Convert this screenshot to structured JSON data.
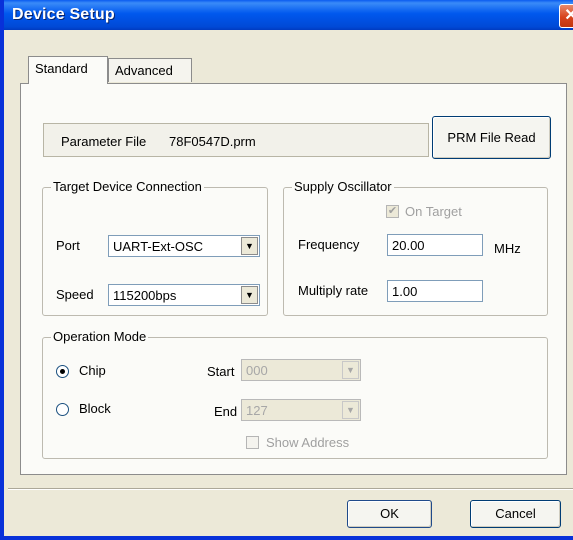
{
  "window": {
    "title": "Device Setup",
    "close_glyph": "✕"
  },
  "tabs": [
    {
      "label": "Standard",
      "active": true
    },
    {
      "label": "Advanced",
      "active": false
    }
  ],
  "parameter_file": {
    "label": "Parameter File",
    "value": "78F0547D.prm",
    "read_button": "PRM File Read"
  },
  "target_connection": {
    "legend": "Target Device Connection",
    "port_label": "Port",
    "port_value": "UART-Ext-OSC",
    "speed_label": "Speed",
    "speed_value": "115200bps"
  },
  "supply_oscillator": {
    "legend": "Supply Oscillator",
    "on_target_label": "On Target",
    "on_target_checked": true,
    "frequency_label": "Frequency",
    "frequency_value": "20.00",
    "frequency_unit": "MHz",
    "multiply_label": "Multiply rate",
    "multiply_value": "1.00"
  },
  "operation_mode": {
    "legend": "Operation Mode",
    "chip_label": "Chip",
    "block_label": "Block",
    "selected": "Chip",
    "start_label": "Start",
    "start_value": "000",
    "end_label": "End",
    "end_value": "127",
    "show_address_label": "Show Address"
  },
  "footer": {
    "ok_label": "OK",
    "cancel_label": "Cancel"
  },
  "icons": {
    "dropdown": "chevron-down-icon",
    "check": "check-icon",
    "close": "close-icon"
  }
}
